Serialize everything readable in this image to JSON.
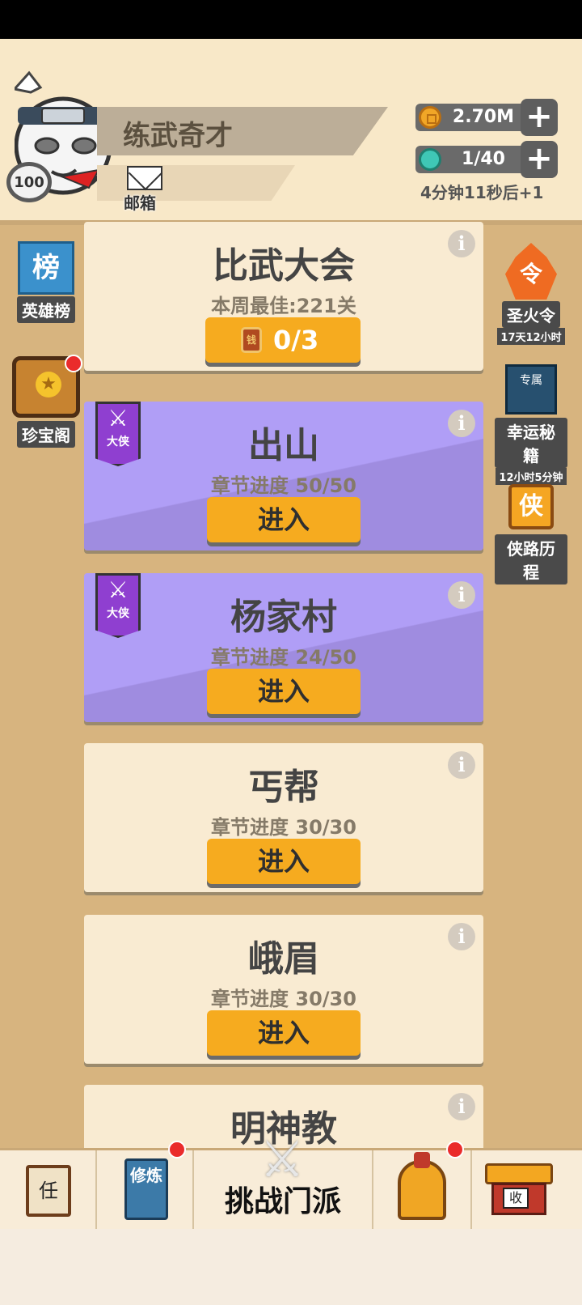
{
  "player": {
    "name": "练武奇才",
    "level": "100",
    "mail_label": "邮箱"
  },
  "resources": {
    "coins": "2.70M",
    "energy": "1/40",
    "plus": "+",
    "energy_timer": "4分钟11秒后+1"
  },
  "left_side": [
    {
      "icon_text": "榜",
      "label": "英雄榜"
    },
    {
      "label": "珍宝阁"
    }
  ],
  "right_side": [
    {
      "icon_text": "令",
      "label": "圣火令",
      "sub": "17天12小时"
    },
    {
      "icon_text": "专属",
      "label": "幸运秘籍",
      "sub": "12小时5分钟"
    },
    {
      "icon_text": "侠",
      "label": "侠路历程"
    }
  ],
  "tournament": {
    "title": "比武大会",
    "best": "本周最佳:221关",
    "ticket_icon_text": "钱",
    "tickets": "0/3"
  },
  "info_glyph": "i",
  "chapters": [
    {
      "title": "出山",
      "progress": "章节进度 50/50",
      "enter": "进入",
      "badge": "大侠",
      "style": "purple"
    },
    {
      "title": "杨家村",
      "progress": "章节进度 24/50",
      "enter": "进入",
      "badge": "大侠",
      "style": "purple"
    },
    {
      "title": "丐帮",
      "progress": "章节进度 30/30",
      "enter": "进入",
      "style": "cream"
    },
    {
      "title": "峨眉",
      "progress": "章节进度 30/30",
      "enter": "进入",
      "style": "cream"
    },
    {
      "title": "明神教",
      "style": "cream"
    }
  ],
  "bottom_nav": {
    "task_icon_text": "任",
    "train_icon_text": "修炼",
    "challenge_label": "挑战门派",
    "collect_icon_text": "收"
  },
  "colors": {
    "accent": "#f6ab1f",
    "purple_card": "#b09ef6",
    "badge": "#ea2b2b"
  }
}
